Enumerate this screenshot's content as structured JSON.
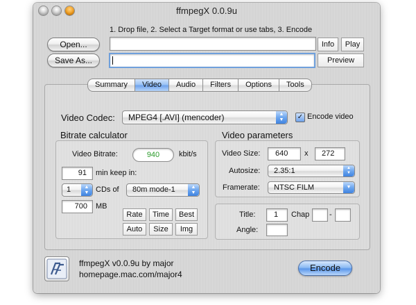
{
  "window": {
    "title": "ffmpegX 0.0.9u"
  },
  "instructions": "1. Drop file, 2. Select a Target format or use tabs, 3. Encode",
  "top": {
    "open_label": "Open...",
    "save_as_label": "Save As...",
    "info_label": "Info",
    "play_label": "Play",
    "preview_label": "Preview",
    "open_path": "",
    "save_path": ""
  },
  "tabs": [
    {
      "label": "Summary",
      "selected": false
    },
    {
      "label": "Video",
      "selected": true
    },
    {
      "label": "Audio",
      "selected": false
    },
    {
      "label": "Filters",
      "selected": false
    },
    {
      "label": "Options",
      "selected": false
    },
    {
      "label": "Tools",
      "selected": false
    }
  ],
  "video_codec": {
    "label": "Video Codec:",
    "value": "MPEG4 [.AVI] (mencoder)",
    "encode_video_label": "Encode video",
    "encode_video_checked": true
  },
  "bitrate": {
    "section_title": "Bitrate calculator",
    "video_bitrate_label": "Video Bitrate:",
    "video_bitrate_value": "940",
    "unit": "kbit/s",
    "minutes_value": "91",
    "minutes_label": "min keep in:",
    "cds_value": "1",
    "cds_label": "CDs of",
    "cd_type_value": "80m mode-1",
    "mb_value": "700",
    "mb_label": "MB",
    "buttons": [
      "Rate",
      "Time",
      "Best",
      "Auto",
      "Size",
      "Img"
    ]
  },
  "video_params": {
    "section_title": "Video parameters",
    "size_label": "Video Size:",
    "width": "640",
    "x_label": "x",
    "height": "272",
    "autosize_label": "Autosize:",
    "autosize_value": "2.35:1",
    "framerate_label": "Framerate:",
    "framerate_value": "NTSC FILM"
  },
  "title_chap": {
    "title_label": "Title:",
    "title_value": "1",
    "chap_label": "Chap",
    "chap_from": "",
    "dash": "-",
    "chap_to": "",
    "angle_label": "Angle:",
    "angle_value": ""
  },
  "footer": {
    "app_line": "ffmpegX v0.0.9u by major",
    "url_line": "homepage.mac.com/major4",
    "encode_label": "Encode"
  }
}
